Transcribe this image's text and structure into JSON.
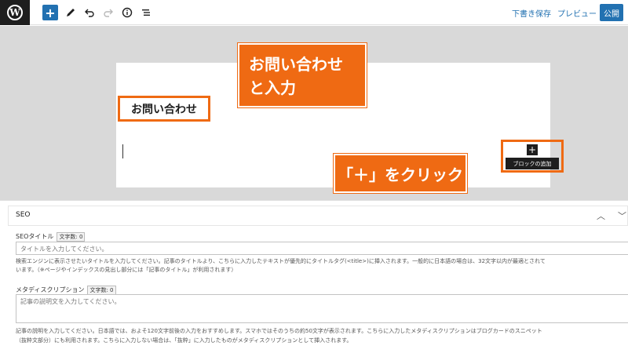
{
  "toolbar": {
    "wp_logo_letter": "W",
    "add_icon_glyph": "+",
    "draft_save": "下書き保存",
    "preview": "プレビュー",
    "publish": "公開"
  },
  "editor": {
    "heading_text": "お問い合わせ",
    "inserter_glyph": "+",
    "inserter_tooltip": "ブロックの追加"
  },
  "callouts": {
    "c1_line1": "お問い合わせ",
    "c1_line2": "と入力",
    "c2": "「＋」をクリック"
  },
  "seo": {
    "panel_title": "SEO",
    "title_label": "SEOタイトル",
    "title_count": "文字数: 0",
    "title_placeholder": "タイトルを入力してください。",
    "title_help_1": "検索エンジンに表示させたいタイトルを入力してください。記事のタイトルより、こちらに入力したテキストが優先的にタイトルタグ(<title>)に挿入されます。一般的に日本語の場合は、32文字以内が最適とされて",
    "title_help_2": "います。（※ページやインデックスの見出し部分には「記事のタイトル」が利用されます）",
    "desc_label": "メタディスクリプション",
    "desc_count": "文字数: 0",
    "desc_placeholder": "記事の説明文を入力してください。",
    "desc_help_1": "記事の説明を入力してください。日本語では、およそ120文字前後の入力をおすすめします。スマホではそのうちの約50文字が表示されます。こちらに入力したメタディスクリプションはブログカードのスニペット",
    "desc_help_2": "（抜粋文部分）にも利用されます。こちらに入力しない場合は、「抜粋」に入力したものがメタディスクリプションとして挿入されます。"
  },
  "colors": {
    "accent": "#2271b1",
    "callout": "#ef6a13",
    "canvas": "#d9d9d9"
  }
}
